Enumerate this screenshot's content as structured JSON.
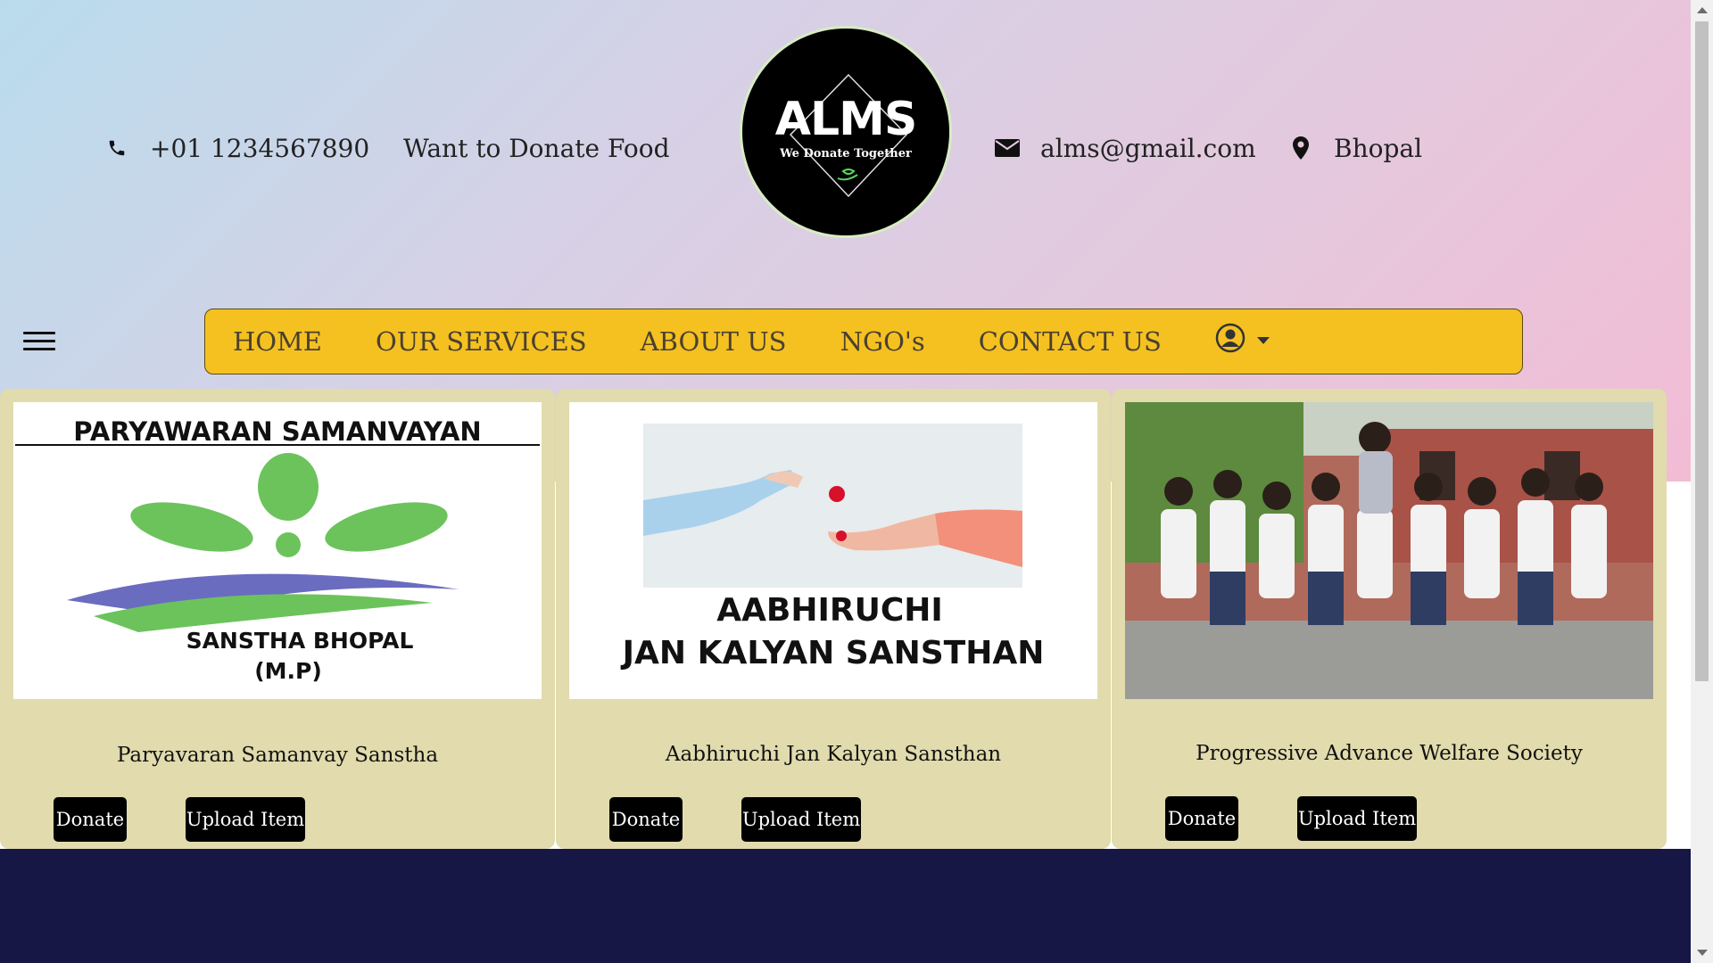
{
  "header": {
    "phone": "+01 1234567890",
    "donate_text": "Want to Donate Food",
    "email": "alms@gmail.com",
    "location": "Bhopal",
    "logo": {
      "title": "ALMS",
      "tagline": "We Donate Together"
    }
  },
  "nav": {
    "items": [
      "HOME",
      "OUR SERVICES",
      "ABOUT US",
      "NGO's",
      "CONTACT US"
    ]
  },
  "cards": [
    {
      "name": "Paryavaran Samanvay Sanstha",
      "image_text": [
        "PARYAWARAN SAMANVAYAN",
        "SANSTHA BHOPAL",
        "(M.P)"
      ],
      "donate_label": "Donate",
      "upload_label": "Upload Item"
    },
    {
      "name": "Aabhiruchi Jan Kalyan Sansthan",
      "image_text": [
        "AABHIRUCHI",
        "JAN KALYAN SANSTHAN"
      ],
      "donate_label": "Donate",
      "upload_label": "Upload Item"
    },
    {
      "name": "Progressive Advance Welfare Society",
      "donate_label": "Donate",
      "upload_label": "Upload Item"
    }
  ],
  "colors": {
    "nav_bg": "#f4c121",
    "card_bg": "#e1dbad",
    "footer_bg": "#161744",
    "button_bg": "#000000"
  }
}
